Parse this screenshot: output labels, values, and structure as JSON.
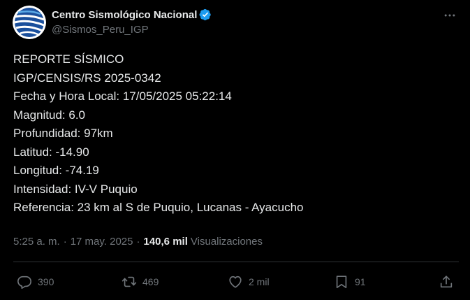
{
  "colors": {
    "background": "#000000",
    "text": "#e7e9ea",
    "secondary_text": "#71767b",
    "verified_badge": "#1d9bf0",
    "divider": "#2f3336"
  },
  "author": {
    "display_name": "Centro Sismológico Nacional",
    "handle": "@Sismos_Peru_IGP",
    "verified": true,
    "avatar_icon": "seismic-globe-logo"
  },
  "tweet": {
    "lines": [
      "REPORTE SÍSMICO",
      "IGP/CENSIS/RS 2025-0342",
      "Fecha y Hora Local: 17/05/2025 05:22:14",
      "Magnitud: 6.0",
      "Profundidad: 97km",
      "Latitud: -14.90",
      "Longitud: -74.19",
      "Intensidad: IV-V Puquio",
      "Referencia: 23 km al S de Puquio, Lucanas - Ayacucho"
    ]
  },
  "meta": {
    "time": "5:25 a. m.",
    "separator": "·",
    "date": "17 may. 2025",
    "views_count": "140,6 mil",
    "views_label": "Visualizaciones"
  },
  "actions": {
    "reply": {
      "icon": "reply-icon",
      "count": "390"
    },
    "retweet": {
      "icon": "retweet-icon",
      "count": "469"
    },
    "like": {
      "icon": "heart-icon",
      "count": "2 mil"
    },
    "bookmark": {
      "icon": "bookmark-icon",
      "count": "91"
    },
    "share": {
      "icon": "share-icon"
    }
  },
  "more_menu_icon": "more-dots-icon"
}
